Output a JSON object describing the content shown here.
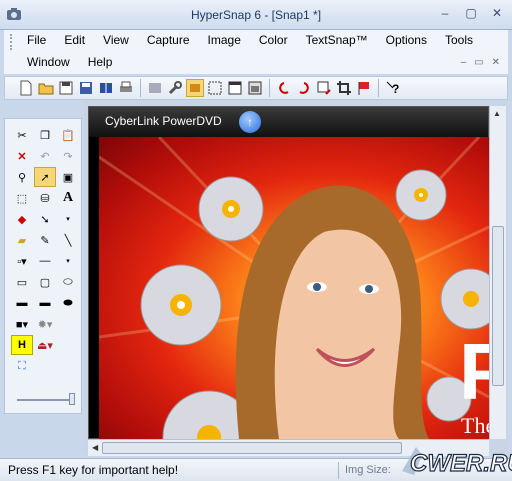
{
  "window": {
    "title": "HyperSnap 6 - [Snap1 *]"
  },
  "menu": {
    "row1": [
      "File",
      "Edit",
      "View",
      "Capture",
      "Image",
      "Color",
      "TextSnap™",
      "Options",
      "Tools"
    ],
    "row2": [
      "Window",
      "Help"
    ]
  },
  "capture": {
    "window_title": "CyberLink PowerDVD",
    "visible_letters": [
      "P",
      "The"
    ]
  },
  "statusbar": {
    "help_text": "Press F1 key for important help!",
    "img_size_label": "Img Size:"
  },
  "watermark": {
    "text": "CWER.RU"
  },
  "colors": {
    "title_text": "#1e3a64",
    "accent": "#2a6edb",
    "bg": "#c8d7ea"
  }
}
